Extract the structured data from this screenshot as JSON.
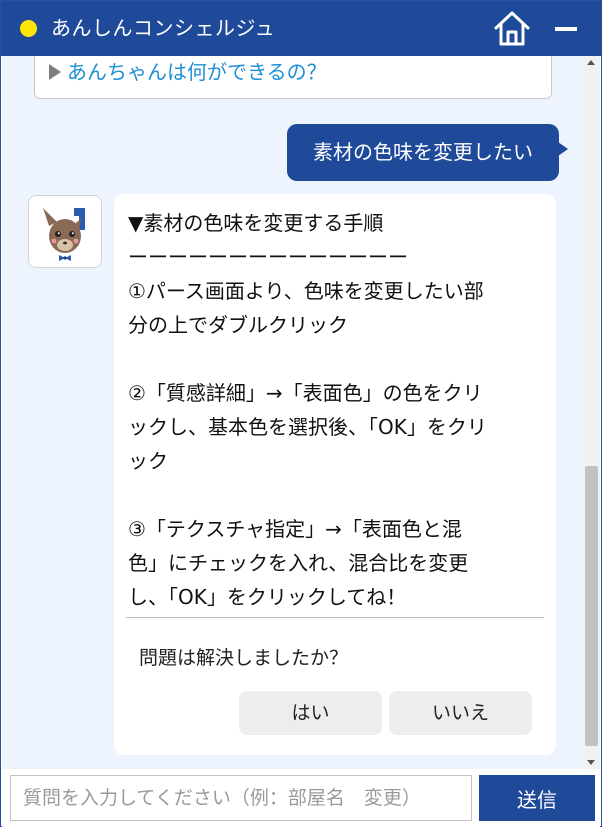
{
  "header": {
    "title": "あんしんコンシェルジュ",
    "status_color": "#ffe600",
    "home_icon": "home-icon",
    "minimize_icon": "minimize-icon"
  },
  "suggestion": {
    "label": "あんちゃんは何ができるの？"
  },
  "user_message": "素材の色味を変更したい",
  "bot_message": {
    "lines": [
      "▼素材の色味を変更する手順",
      "ーーーーーーーーーーーーーー",
      "①パース画面より、色味を変更したい部",
      "分の上でダブルクリック",
      "",
      "②「質感詳細」→「表面色」の色をクリ",
      "ックし、基本色を選択後、「OK」をクリ",
      "ック",
      "",
      "③「テクスチャ指定」→「表面色と混",
      "色」にチェックを入れ、混合比を変更",
      "し、「OK」をクリックしてね！"
    ],
    "question": "問題は解決しましたか？",
    "yes_label": "はい",
    "no_label": "いいえ"
  },
  "input": {
    "placeholder": "質問を入力してください（例：部屋名　変更）",
    "value": ""
  },
  "send_label": "送信",
  "colors": {
    "brand": "#1f4a9a",
    "chat_bg": "#eef4fd",
    "link": "#1e8fd6"
  }
}
